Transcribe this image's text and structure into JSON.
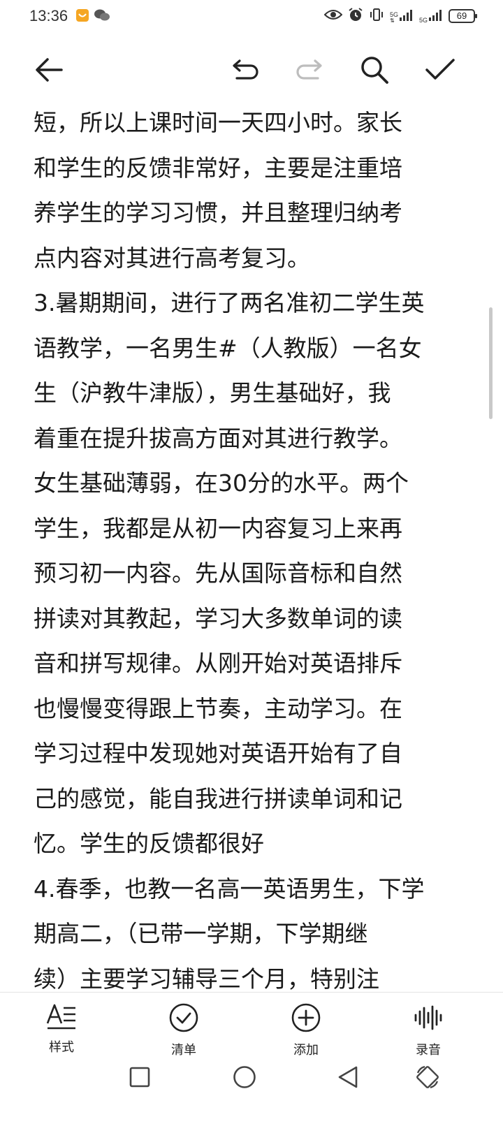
{
  "status_bar": {
    "time": "13:36",
    "left_icons": [
      "app-notification-icon",
      "wechat-icon"
    ],
    "signal1_label": "5G",
    "signal2_label": "5G",
    "battery": "69"
  },
  "toolbar": {
    "icons": [
      "back-arrow-icon",
      "undo-icon",
      "redo-icon",
      "search-icon",
      "confirm-check-icon"
    ]
  },
  "content": {
    "lines": [
      "短，所以上课时间一天四小时。家长",
      "和学生的反馈非常好，主要是注重培",
      "养学生的学习习惯，并且整理归纳考",
      "点内容对其进行高考复习。",
      "3.暑期期间，进行了两名准初二学生英",
      "语教学，一名男生#（人教版）一名女",
      "生（沪教牛津版），男生基础好，我",
      "着重在提升拔高方面对其进行教学。",
      "女生基础薄弱，在30分的水平。两个",
      "学生，我都是从初一内容复习上来再",
      "预习初一内容。先从国际音标和自然",
      "拼读对其教起，学习大多数单词的读",
      "音和拼写规律。从刚开始对英语排斥",
      "也慢慢变得跟上节奏，主动学习。在",
      "学习过程中发现她对英语开始有了自",
      "己的感觉，能自我进行拼读单词和记",
      "忆。学生的反馈都很好",
      "4.春季，也教一名高一英语男生，下学",
      "期高二，（已带一学期，下学期继",
      "续）主要学习辅导三个月，特别注"
    ]
  },
  "bottom_bar": {
    "style_label": "样式",
    "checklist_label": "清单",
    "add_label": "添加",
    "record_label": "录音"
  },
  "nav_bar": {
    "icons": [
      "recent-apps-icon",
      "home-icon",
      "back-icon",
      "rotate-screen-icon"
    ]
  }
}
